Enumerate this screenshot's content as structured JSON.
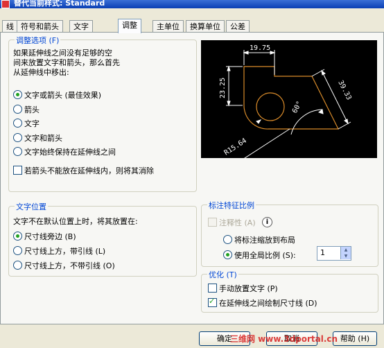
{
  "window": {
    "title": "替代当前样式: Standard"
  },
  "tabs": [
    {
      "label": "线"
    },
    {
      "label": "符号和箭头"
    },
    {
      "label": "文字"
    },
    {
      "label": "调整"
    },
    {
      "label": "主单位"
    },
    {
      "label": "换算单位"
    },
    {
      "label": "公差"
    }
  ],
  "fit_options": {
    "legend": "调整选项 (F)",
    "description_lines": [
      "如果延伸线之间没有足够的空",
      "间来放置文字和箭头，那么首先",
      "从延伸线中移出:"
    ],
    "radios": [
      {
        "label": "文字或箭头 (最佳效果)",
        "selected": true
      },
      {
        "label": "箭头",
        "selected": false
      },
      {
        "label": "文字",
        "selected": false
      },
      {
        "label": "文字和箭头",
        "selected": false
      },
      {
        "label": "文字始终保持在延伸线之间",
        "selected": false
      }
    ],
    "suppress_check": {
      "label": "若箭头不能放在延伸线内，则将其消除",
      "checked": false
    }
  },
  "preview": {
    "dims": [
      "19.75",
      "23.25",
      "39.33",
      "60°",
      "R15.64"
    ]
  },
  "text_placement": {
    "legend": "文字位置",
    "description": "文字不在默认位置上时，将其放置在:",
    "radios": [
      {
        "label": "尺寸线旁边 (B)",
        "selected": true
      },
      {
        "label": "尺寸线上方，带引线 (L)",
        "selected": false
      },
      {
        "label": "尺寸线上方，不带引线 (O)",
        "selected": false
      }
    ]
  },
  "scale": {
    "legend": "标注特征比例",
    "annotative": {
      "label": "注释性 (A)",
      "checked": false
    },
    "radios": [
      {
        "label": "将标注缩放到布局",
        "selected": false
      },
      {
        "label": "使用全局比例 (S):",
        "selected": true
      }
    ],
    "global_scale_value": "1"
  },
  "finetune": {
    "legend": "优化 (T)",
    "checks": [
      {
        "label": "手动放置文字 (P)",
        "checked": false
      },
      {
        "label": "在延伸线之间绘制尺寸线 (D)",
        "checked": true
      }
    ]
  },
  "buttons": {
    "ok": "确定",
    "cancel": "取消",
    "help": "帮助 (H)"
  },
  "watermark": "三维网 www.3dportal.cn",
  "colors": {
    "dim_white": "#ffffff",
    "shape_orange": "#d98b2a",
    "preview_bg": "#000000"
  }
}
